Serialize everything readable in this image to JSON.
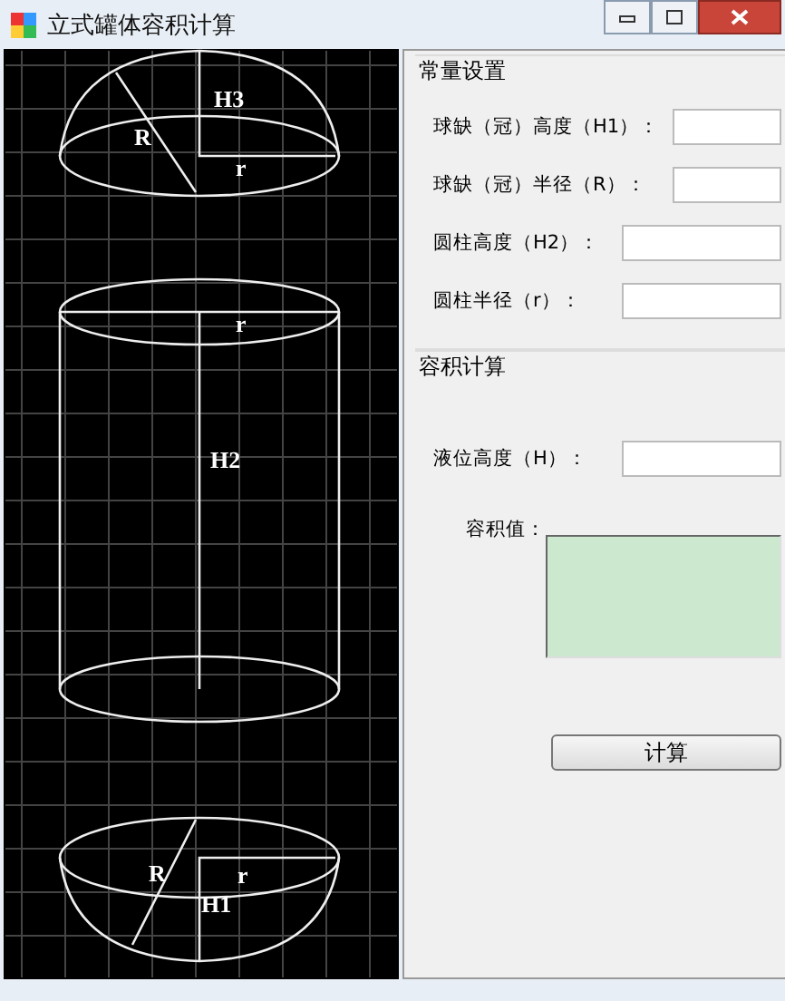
{
  "window": {
    "title": "立式罐体容积计算"
  },
  "drawing": {
    "labels": [
      {
        "text": "H3"
      },
      {
        "text": "R"
      },
      {
        "text": "r"
      },
      {
        "text": "r"
      },
      {
        "text": "H2"
      },
      {
        "text": "R"
      },
      {
        "text": "r"
      },
      {
        "text": "H1"
      }
    ]
  },
  "constants": {
    "title": "常量设置",
    "fields": [
      {
        "label": "球缺（冠）高度（H1）："
      },
      {
        "label": "球缺（冠）半径（R）："
      },
      {
        "label": "圆柱高度（H2）："
      },
      {
        "label": "圆柱半径（r）："
      }
    ]
  },
  "calculation": {
    "title": "容积计算",
    "level_label": "液位高度（H）：",
    "result_label": "容积值：",
    "button": "计算"
  }
}
